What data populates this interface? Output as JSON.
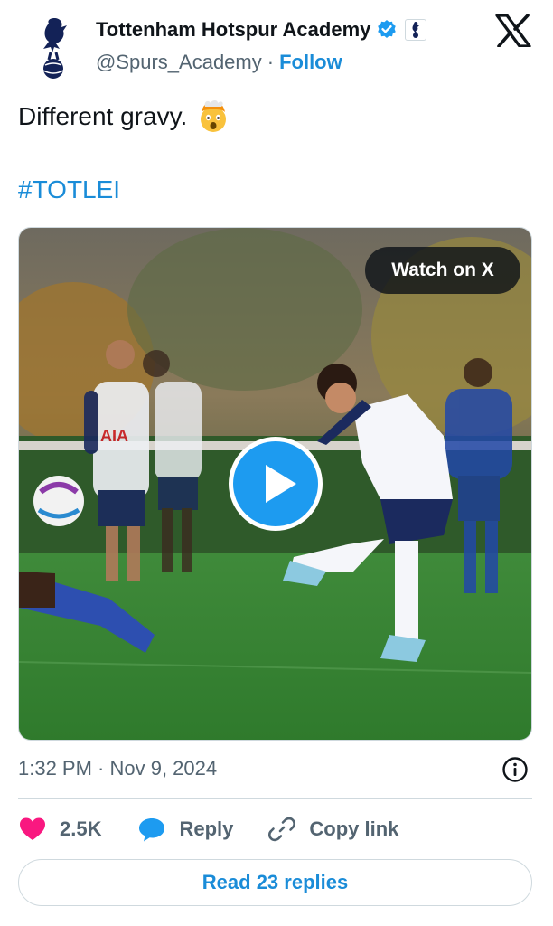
{
  "account": {
    "name": "Tottenham Hotspur Academy",
    "handle": "@Spurs_Academy",
    "separator": "·",
    "follow_label": "Follow"
  },
  "tweet": {
    "text": "Different gravy.",
    "hashtag": "#TOTLEI"
  },
  "media": {
    "watch_label": "Watch on X",
    "shirt_sponsor": "AIA"
  },
  "timestamp": "1:32 PM · Nov 9, 2024",
  "actions": {
    "likes": "2.5K",
    "reply_label": "Reply",
    "copy_label": "Copy link"
  },
  "read_replies_label": "Read 23 replies",
  "icons": {
    "avatar": "spurs-cockerel-icon",
    "verified": "verified-badge-icon",
    "affiliate": "affiliate-badge-icon",
    "x_logo": "x-logo-icon",
    "emoji": "exploding-head-emoji",
    "play": "play-icon",
    "info": "info-icon",
    "like": "heart-icon",
    "reply": "speech-bubble-icon",
    "copy": "link-icon"
  },
  "colors": {
    "accent": "#1a8cd8",
    "like": "#f91880",
    "muted": "#536471"
  }
}
